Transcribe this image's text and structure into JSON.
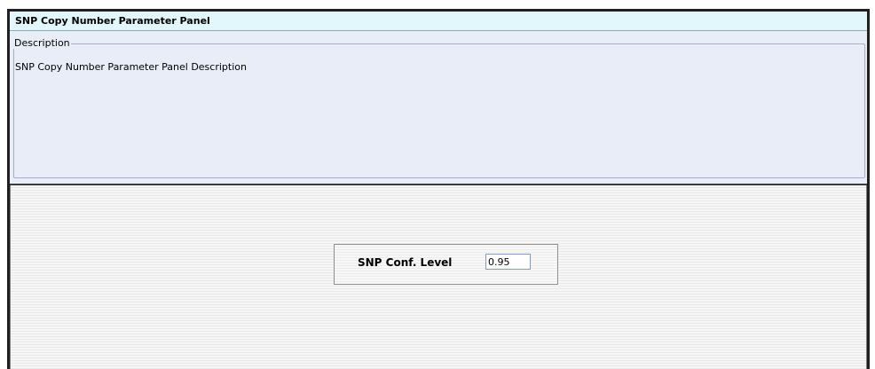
{
  "panel": {
    "title": "SNP Copy Number Parameter Panel"
  },
  "description": {
    "legend": "Description",
    "text": "SNP Copy Number Parameter Panel Description"
  },
  "parameters": {
    "conf_level_label": "SNP Conf. Level",
    "conf_level_value": "0.95"
  },
  "colors": {
    "title_bg": "#e2f7fb",
    "description_bg": "#e9edf8",
    "frame": "#202020"
  }
}
